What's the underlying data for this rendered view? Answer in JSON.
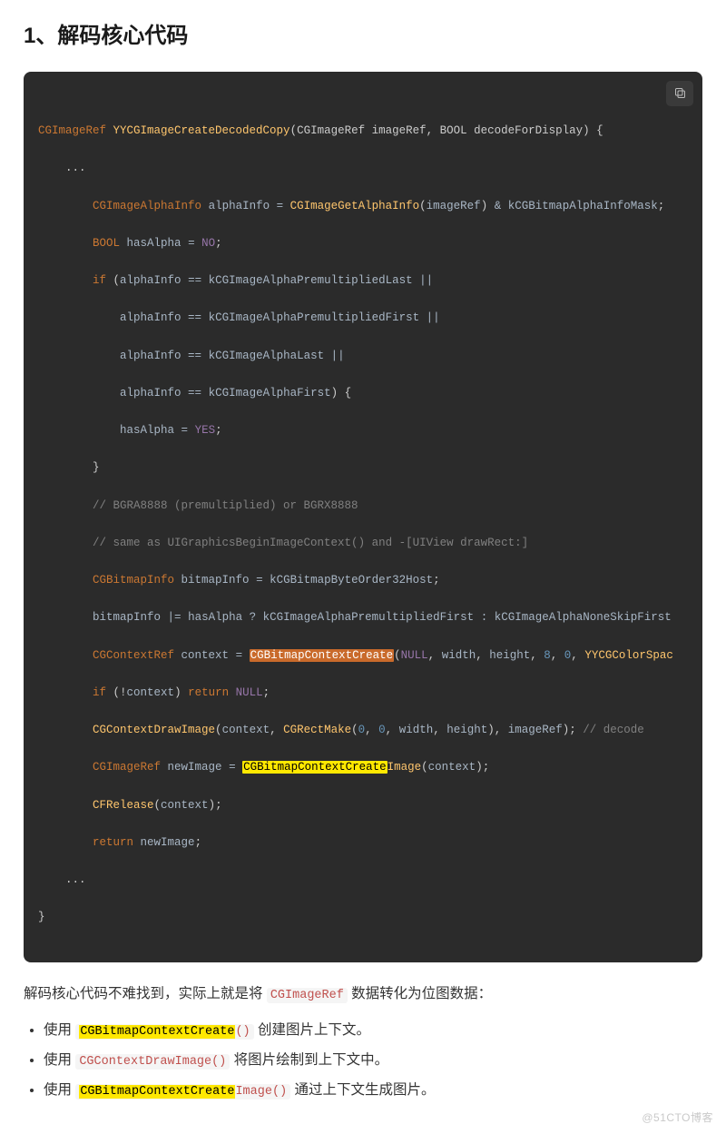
{
  "heading": "1、解码核心代码",
  "copy_label": "Copy",
  "code": {
    "t_CGImageRef": "CGImageRef",
    "fn_YYCGImageCreateDecodedCopy": "YYCGImageCreateDecodedCopy",
    "sig_params": "(CGImageRef imageRef, BOOL decodeForDisplay) {",
    "ellipsis1": "    ...",
    "t_CGImageAlphaInfo": "CGImageAlphaInfo",
    "id_alphaInfo": "alphaInfo",
    "fn_CGImageGetAlphaInfo": "CGImageGetAlphaInfo",
    "id_imageRef": "imageRef",
    "c_kCGBitmapAlphaInfoMask": "kCGBitmapAlphaInfoMask",
    "t_BOOL": "BOOL",
    "id_hasAlpha": "hasAlpha",
    "c_NO": "NO",
    "kw_if": "if",
    "c_kPremLast": "kCGImageAlphaPremultipliedLast",
    "c_kPremFirst": "kCGImageAlphaPremultipliedFirst",
    "c_kLast": "kCGImageAlphaLast",
    "c_kFirst": "kCGImageAlphaFirst",
    "c_YES": "YES",
    "cm_bgra": "// BGRA8888 (premultiplied) or BGRX8888",
    "cm_same": "// same as UIGraphicsBeginImageContext() and -[UIView drawRect:]",
    "t_CGBitmapInfo": "CGBitmapInfo",
    "id_bitmapInfo": "bitmapInfo",
    "c_kByteOrder": "kCGBitmapByteOrder32Host",
    "c_kNoneSkip": "kCGImageAlphaNoneSkipFirst",
    "t_CGContextRef": "CGContextRef",
    "id_context": "context",
    "fn_CGBitmapContextCreate": "CGBitmapContextCreate",
    "c_NULL": "NULL",
    "id_width": "width",
    "id_height": "height",
    "n_8": "8",
    "n_0": "0",
    "id_YYCGColorSpace": "YYCGColorSpac",
    "kw_return": "return",
    "fn_CGContextDrawImage": "CGContextDrawImage",
    "fn_CGRectMake": "CGRectMake",
    "cm_decode": "// decode",
    "id_newImage": "newImage",
    "fn_CGBitmapContextCreateImage_hl": "CGBitmapContextCreate",
    "fn_Image_tail": "Image",
    "fn_CFRelease": "CFRelease",
    "ellipsis2": "    ...",
    "brace_close": "}"
  },
  "paragraph": {
    "pre": "解码核心代码不难找到，实际上就是将 ",
    "inline": "CGImageRef",
    "post": " 数据转化为位图数据："
  },
  "bullets": [
    {
      "pre": "使用 ",
      "code_hl": "CGBitmapContextCreate",
      "code_tail": "()",
      "post": " 创建图片上下文。"
    },
    {
      "pre": "使用 ",
      "code_plain": "CGContextDrawImage()",
      "post": " 将图片绘制到上下文中。"
    },
    {
      "pre": "使用 ",
      "code_hl": "CGBitmapContextCreate",
      "code_mid": "Image",
      "code_tail": "()",
      "post": " 通过上下文生成图片。"
    }
  ],
  "watermark": "@51CTO博客"
}
